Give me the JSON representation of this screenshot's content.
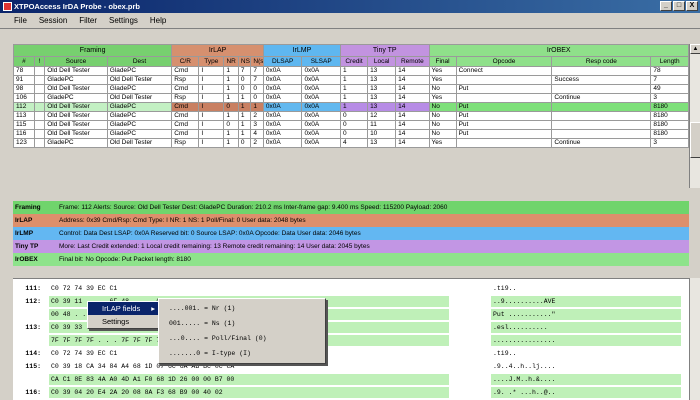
{
  "window": {
    "title": "XTPOAccess IrDA Probe - obex.prb",
    "min": "_",
    "max": "□",
    "close": "X"
  },
  "menu": [
    "File",
    "Session",
    "Filter",
    "Settings",
    "Help"
  ],
  "groups": [
    "Framing",
    "IrLAP",
    "IrLMP",
    "Tiny TP",
    "IrOBEX"
  ],
  "headers": [
    "#",
    "!",
    "Source",
    "Dest",
    "C/R",
    "Type",
    "NR",
    "NS",
    "N(s)",
    "DLSAP",
    "SLSAP",
    "Credit",
    "Local",
    "Remote",
    "Final",
    "Opcode",
    "Resp code",
    "Length"
  ],
  "rows": [
    [
      "78",
      "",
      "Old Dell Tester",
      "GladePC",
      "Cmd",
      "I",
      "1",
      "7",
      "7",
      "0x0A",
      "0x0A",
      "1",
      "13",
      "14",
      "Yes",
      "Connect",
      "",
      "78"
    ],
    [
      "91",
      "",
      "GladePC",
      "Old Dell Tester",
      "Rsp",
      "I",
      "1",
      "0",
      "7",
      "0x0A",
      "0x0A",
      "1",
      "13",
      "14",
      "Yes",
      "",
      "Success",
      "7"
    ],
    [
      "98",
      "",
      "Old Dell Tester",
      "GladePC",
      "Cmd",
      "I",
      "1",
      "0",
      "0",
      "0x0A",
      "0x0A",
      "1",
      "13",
      "14",
      "No",
      "Put",
      "",
      "49"
    ],
    [
      "106",
      "",
      "GladePC",
      "Old Dell Tester",
      "Rsp",
      "I",
      "1",
      "1",
      "0",
      "0x0A",
      "0x0A",
      "1",
      "13",
      "14",
      "Yes",
      "",
      "Continue",
      "3"
    ],
    [
      "112",
      "",
      "Old Dell Tester",
      "GladePC",
      "Cmd",
      "I",
      "0",
      "1",
      "1",
      "0x0A",
      "0x0A",
      "1",
      "13",
      "14",
      "No",
      "Put",
      "",
      "8180"
    ],
    [
      "113",
      "",
      "Old Dell Tester",
      "GladePC",
      "Cmd",
      "I",
      "1",
      "1",
      "2",
      "0x0A",
      "0x0A",
      "0",
      "12",
      "14",
      "No",
      "Put",
      "",
      "8180"
    ],
    [
      "115",
      "",
      "Old Dell Tester",
      "GladePC",
      "Cmd",
      "I",
      "0",
      "1",
      "3",
      "0x0A",
      "0x0A",
      "0",
      "11",
      "14",
      "No",
      "Put",
      "",
      "8180"
    ],
    [
      "116",
      "",
      "Old Dell Tester",
      "GladePC",
      "Cmd",
      "I",
      "1",
      "1",
      "4",
      "0x0A",
      "0x0A",
      "0",
      "10",
      "14",
      "No",
      "Put",
      "",
      "8180"
    ],
    [
      "123",
      "",
      "GladePC",
      "Old Dell Tester",
      "Rsp",
      "I",
      "1",
      "0",
      "2",
      "0x0A",
      "0x0A",
      "4",
      "13",
      "14",
      "Yes",
      "",
      "Continue",
      "3"
    ]
  ],
  "selected_row": 4,
  "decode": {
    "framing": {
      "label": "Framing",
      "text": "Frame: 112  Alerts:  Source: Old Dell Tester  Dest: GladePC  Duration: 210.2 ms  Inter-frame gap: 9.400 ms  Speed: 115200  Payload: 2060"
    },
    "irlap": {
      "label": "IrLAP",
      "text": "Address: 0x39  Cmd/Rsp: Cmd  Type: I  NR: 1  NS: 1  Poll/Final: 0  User data: 2048 bytes"
    },
    "irlmp": {
      "label": "IrLMP",
      "text": "Control: Data  Dest LSAP: 0x0A  Reserved bit: 0  Source LSAP: 0x0A  Opcode: Data  User data: 2046 bytes"
    },
    "tinytp": {
      "label": "Tiny TP",
      "text": "More: Last  Credit extended: 1  Local credit remaining: 13  Remote credit remaining: 14  User data: 2045 bytes"
    },
    "irobex": {
      "label": "IrOBEX",
      "text": "Final bit: No  Opcode: Put  Packet length: 8180"
    }
  },
  "hex": [
    {
      "frame": "111:",
      "bytes": "C0 72 74 39   EC C1",
      "ascii": ".ti9..",
      "plain": true
    },
    {
      "frame": "112:",
      "bytes": "C0 39 11 . . . 6F 48 . . . 04 27 03 00   1F 41 56 45",
      "ascii": "..9..........AVE"
    },
    {
      "frame": "",
      "bytes": "00 48 . . . 1F 1F 2F 1F 00 . . . 01 00 00 00",
      "ascii": "Put ...........\""
    },
    {
      "frame": "113:",
      "bytes": "C0 39 33 . . . 7F 7F 7F 7F   7F 7F 8D 7F",
      "ascii": ".esl.........."
    },
    {
      "frame": "",
      "bytes": "7F 7F 7F 7F . . . 7F 7F 7F 7F   7F 7F 7F 7F",
      "ascii": "................"
    },
    {
      "frame": "114:",
      "bytes": "C0 72 74 39   EC C1",
      "ascii": ".ti9..",
      "plain": true
    },
    {
      "frame": "115:",
      "bytes": "C0 39 18 CA 34 84 A4 68   1D 07 6C 6A   AB BC 0C CA",
      "ascii": ".9..4..h..lj....",
      "plain": true
    },
    {
      "frame": "",
      "bytes": "CA C1 8E 83 4A A0 4D A1   F0 68 1D 26 00 00 B7 00",
      "ascii": "....J.M..h.&...."
    },
    {
      "frame": "116:",
      "bytes": "C0 39 04 20 E4 2A 20 08   8A F3 68 B9 00 40 02",
      "ascii": ".9. .* ...h..@.."
    }
  ],
  "context_menu": {
    "items": [
      "IrLAP fields",
      "Settings"
    ],
    "arrow": "▸"
  },
  "submenu": {
    "items": [
      "....001.  =  Nr (1)",
      "001.....  =  Ns (1)",
      "...0....  =  Poll/Final (0)",
      ".......0  =  I-type (I)"
    ]
  }
}
